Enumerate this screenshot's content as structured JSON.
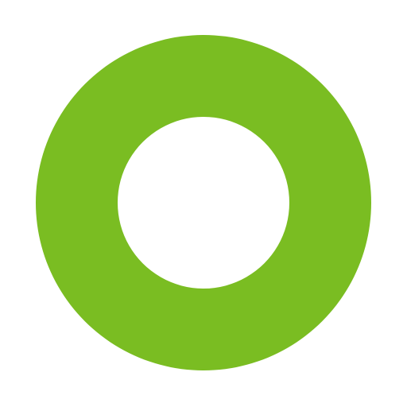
{
  "graphic": {
    "icon": "ring-icon",
    "colors": {
      "ring": "#7abd22",
      "background": "#ffffff"
    }
  }
}
